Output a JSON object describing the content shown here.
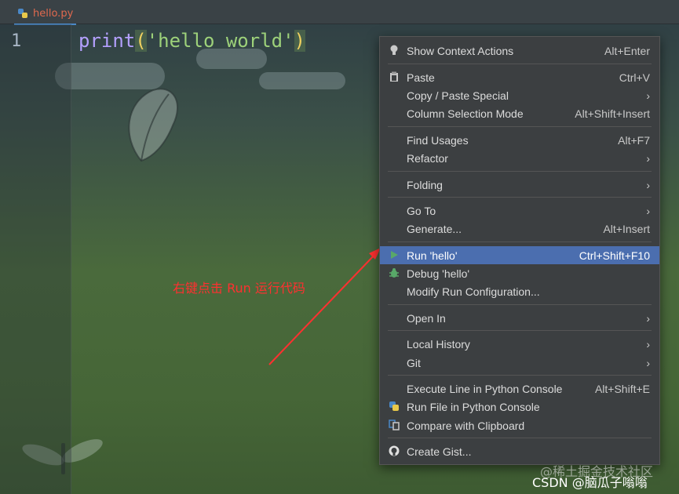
{
  "editor": {
    "tab_label": "hello.py",
    "line_number": "1",
    "code": {
      "keyword": "print",
      "open_paren": "(",
      "string": "'hello world'",
      "close_paren": ")"
    }
  },
  "context_menu": {
    "items": [
      {
        "label": "Show Context Actions",
        "shortcut": "Alt+Enter",
        "icon": "lightbulb-icon"
      },
      {
        "label": "Paste",
        "shortcut": "Ctrl+V",
        "icon": "clipboard-icon"
      },
      {
        "label": "Copy / Paste Special",
        "submenu": "›"
      },
      {
        "label": "Column Selection Mode",
        "shortcut": "Alt+Shift+Insert"
      },
      {
        "label": "Find Usages",
        "shortcut": "Alt+F7"
      },
      {
        "label": "Refactor",
        "submenu": "›"
      },
      {
        "label": "Folding",
        "submenu": "›"
      },
      {
        "label": "Go To",
        "submenu": "›"
      },
      {
        "label": "Generate...",
        "shortcut": "Alt+Insert"
      },
      {
        "label": "Run 'hello'",
        "shortcut": "Ctrl+Shift+F10",
        "icon": "run-icon",
        "selected": true
      },
      {
        "label": "Debug 'hello'",
        "icon": "debug-icon"
      },
      {
        "label": "Modify Run Configuration..."
      },
      {
        "label": "Open In",
        "submenu": "›"
      },
      {
        "label": "Local History",
        "submenu": "›"
      },
      {
        "label": "Git",
        "submenu": "›"
      },
      {
        "label": "Execute Line in Python Console",
        "shortcut": "Alt+Shift+E"
      },
      {
        "label": "Run File in Python Console",
        "icon": "python-icon"
      },
      {
        "label": "Compare with Clipboard",
        "icon": "compare-icon"
      },
      {
        "label": "Create Gist...",
        "icon": "github-icon"
      }
    ]
  },
  "annotation": "右键点击 Run 运行代码",
  "watermark": {
    "line1": "@稀土掘金技术社区",
    "line2": "CSDN @脑瓜子嗡嗡"
  },
  "colors": {
    "menu_bg": "#3c3f41",
    "selection": "#4b6eaf",
    "annotation": "#ff3030"
  }
}
